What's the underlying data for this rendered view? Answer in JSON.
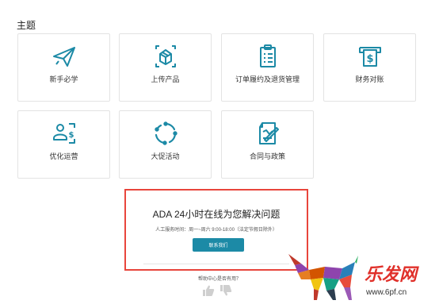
{
  "section_title": "主题",
  "cards": [
    {
      "label": "新手必学",
      "icon": "paper-plane-icon"
    },
    {
      "label": "上传产品",
      "icon": "upload-box-icon"
    },
    {
      "label": "订单履约及退货管理",
      "icon": "clipboard-list-icon"
    },
    {
      "label": "财务对账",
      "icon": "dollar-bill-icon"
    },
    {
      "label": "优化运营",
      "icon": "user-dollar-icon"
    },
    {
      "label": "大促活动",
      "icon": "refresh-cycle-icon"
    },
    {
      "label": "合同与政策",
      "icon": "contract-document-icon"
    }
  ],
  "help": {
    "title": "ADA 24小时在线为您解决问题",
    "hours": "人工服务时间：周一~周六 9:00-18:00（法定节假日除外）",
    "contact_button": "联系我们"
  },
  "feedback": {
    "question": "帮助中心是否有用？"
  },
  "watermark": {
    "brand": "乐发网",
    "url": "www.6pf.cn"
  },
  "colors": {
    "accent": "#1c8aa6",
    "highlight_border": "#e8453c",
    "icon": "#1c8aa6"
  }
}
